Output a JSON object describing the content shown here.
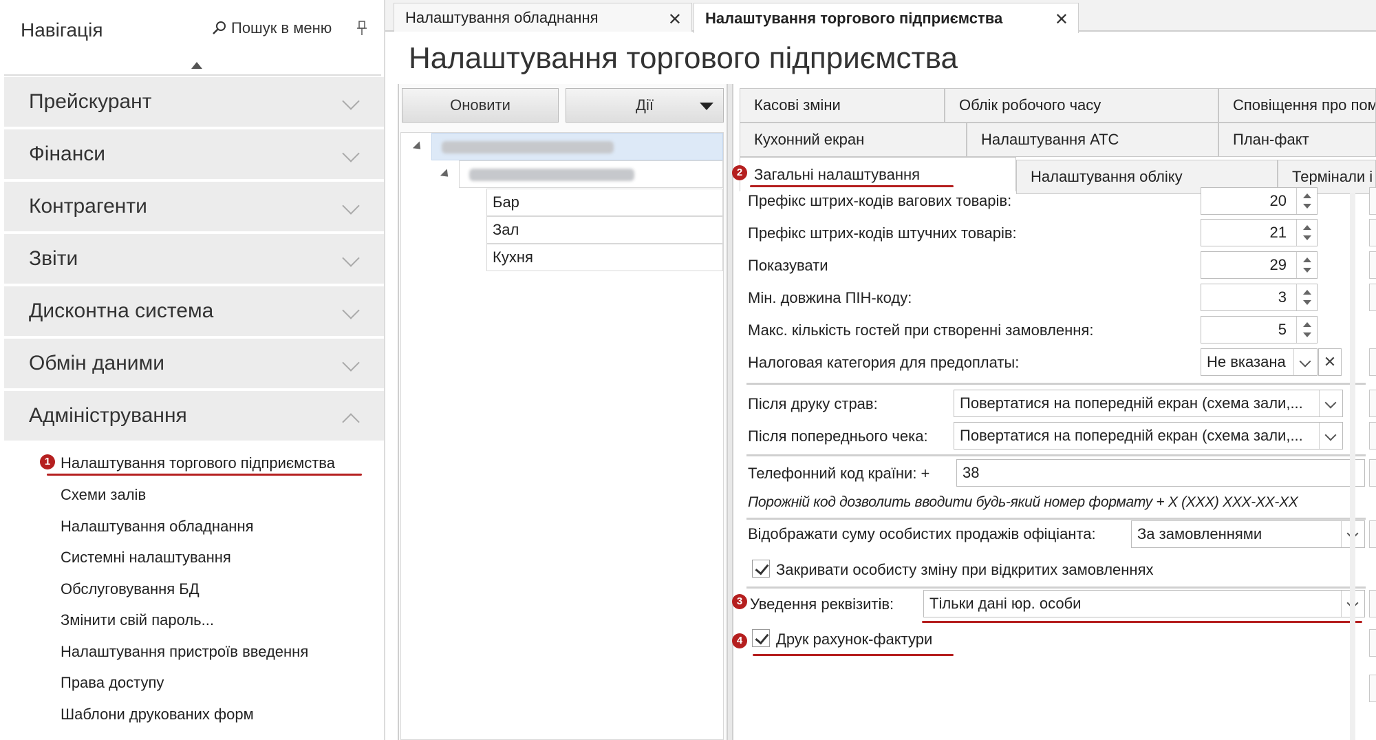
{
  "nav": {
    "title": "Навігація",
    "search_label": "Пошук в меню",
    "sections": [
      {
        "label": "Прейскурант"
      },
      {
        "label": "Фінанси"
      },
      {
        "label": "Контрагенти"
      },
      {
        "label": "Звіти"
      },
      {
        "label": "Дисконтна система"
      },
      {
        "label": "Обмін даними"
      },
      {
        "label": "Адміністрування"
      }
    ],
    "admin_items": [
      "Налаштування торгового підприємства",
      "Схеми залів",
      "Налаштування обладнання",
      "Системні налаштування",
      "Обслуговування БД",
      "Змінити свій пароль...",
      "Налаштування пристроїв введення",
      "Права доступу",
      "Шаблони друкованих форм"
    ]
  },
  "tabs": [
    {
      "label": "Налаштування обладнання"
    },
    {
      "label": "Налаштування торгового підприємства"
    }
  ],
  "page_title": "Налаштування торгового підприємства",
  "toolbar": {
    "refresh_label": "Оновити",
    "actions_label": "Дії"
  },
  "tree": {
    "children": [
      "Бар",
      "Зал",
      "Кухня"
    ]
  },
  "settings_tabs": {
    "row1": [
      "Касові зміни",
      "Облік робочого часу",
      "Сповіщення про пом"
    ],
    "row2": [
      "Кухонний екран",
      "Налаштування АТС",
      "План-факт"
    ],
    "row3": [
      "Загальні налаштування",
      "Налаштування обліку",
      "Термінали і"
    ]
  },
  "fields": {
    "weight_prefix": {
      "label": "Префікс штрих-кодів вагових товарів:",
      "value": "20"
    },
    "piece_prefix": {
      "label": "Префікс штрих-кодів штучних товарів:",
      "value": "21"
    },
    "show": {
      "label": "Показувати",
      "value": "29"
    },
    "pin_min": {
      "label": "Мін. довжина ПІН-коду:",
      "value": "3"
    },
    "max_guests": {
      "label": "Макс. кількість гостей при створенні замовлення:",
      "value": "5"
    },
    "tax_category": {
      "label": "Налоговая категория для предоплаты:",
      "value": "Не вказана"
    },
    "after_dish_print": {
      "label": "Після друку страв:",
      "value": "Повертатися на попередній екран (схема зали,..."
    },
    "after_precheck": {
      "label": "Після попереднього чека:",
      "value": "Повертатися на попередній екран (схема зали,..."
    },
    "phone_code": {
      "label": "Телефонний код країни: +",
      "value": "38"
    },
    "phone_hint": "Порожній код дозволить вводити будь-який номер формату + X (XXX) XXX-XX-XX",
    "personal_sales": {
      "label": "Відображати суму особистих продажів офіціанта:",
      "value": "За замовленнями"
    },
    "close_shift": {
      "label": "Закривати особисту зміну при відкритих замовленнях",
      "checked": true
    },
    "requisites": {
      "label": "Уведення реквізитів:",
      "value": "Тільки дані юр. особи"
    },
    "print_invoice": {
      "label": "Друк рахунок-фактури",
      "checked": true
    }
  },
  "annotations": [
    "1",
    "2",
    "3",
    "4"
  ],
  "colors": {
    "annotation": "#b51f1f",
    "selected_row": "#dde9f7",
    "section_bg": "#ececec"
  }
}
